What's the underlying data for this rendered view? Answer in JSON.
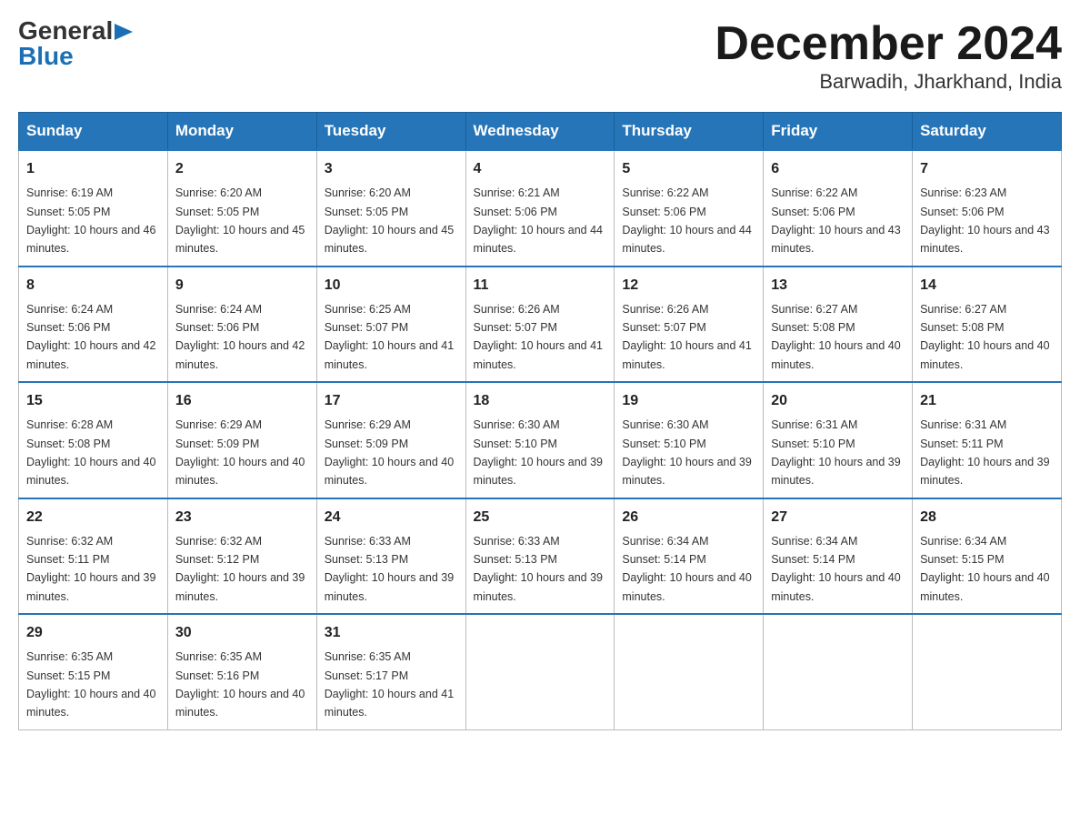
{
  "logo": {
    "general": "General",
    "blue": "Blue",
    "arrow": "▶"
  },
  "title": "December 2024",
  "subtitle": "Barwadih, Jharkhand, India",
  "weekdays": [
    "Sunday",
    "Monday",
    "Tuesday",
    "Wednesday",
    "Thursday",
    "Friday",
    "Saturday"
  ],
  "weeks": [
    [
      {
        "day": 1,
        "sunrise": "6:19 AM",
        "sunset": "5:05 PM",
        "daylight": "10 hours and 46 minutes."
      },
      {
        "day": 2,
        "sunrise": "6:20 AM",
        "sunset": "5:05 PM",
        "daylight": "10 hours and 45 minutes."
      },
      {
        "day": 3,
        "sunrise": "6:20 AM",
        "sunset": "5:05 PM",
        "daylight": "10 hours and 45 minutes."
      },
      {
        "day": 4,
        "sunrise": "6:21 AM",
        "sunset": "5:06 PM",
        "daylight": "10 hours and 44 minutes."
      },
      {
        "day": 5,
        "sunrise": "6:22 AM",
        "sunset": "5:06 PM",
        "daylight": "10 hours and 44 minutes."
      },
      {
        "day": 6,
        "sunrise": "6:22 AM",
        "sunset": "5:06 PM",
        "daylight": "10 hours and 43 minutes."
      },
      {
        "day": 7,
        "sunrise": "6:23 AM",
        "sunset": "5:06 PM",
        "daylight": "10 hours and 43 minutes."
      }
    ],
    [
      {
        "day": 8,
        "sunrise": "6:24 AM",
        "sunset": "5:06 PM",
        "daylight": "10 hours and 42 minutes."
      },
      {
        "day": 9,
        "sunrise": "6:24 AM",
        "sunset": "5:06 PM",
        "daylight": "10 hours and 42 minutes."
      },
      {
        "day": 10,
        "sunrise": "6:25 AM",
        "sunset": "5:07 PM",
        "daylight": "10 hours and 41 minutes."
      },
      {
        "day": 11,
        "sunrise": "6:26 AM",
        "sunset": "5:07 PM",
        "daylight": "10 hours and 41 minutes."
      },
      {
        "day": 12,
        "sunrise": "6:26 AM",
        "sunset": "5:07 PM",
        "daylight": "10 hours and 41 minutes."
      },
      {
        "day": 13,
        "sunrise": "6:27 AM",
        "sunset": "5:08 PM",
        "daylight": "10 hours and 40 minutes."
      },
      {
        "day": 14,
        "sunrise": "6:27 AM",
        "sunset": "5:08 PM",
        "daylight": "10 hours and 40 minutes."
      }
    ],
    [
      {
        "day": 15,
        "sunrise": "6:28 AM",
        "sunset": "5:08 PM",
        "daylight": "10 hours and 40 minutes."
      },
      {
        "day": 16,
        "sunrise": "6:29 AM",
        "sunset": "5:09 PM",
        "daylight": "10 hours and 40 minutes."
      },
      {
        "day": 17,
        "sunrise": "6:29 AM",
        "sunset": "5:09 PM",
        "daylight": "10 hours and 40 minutes."
      },
      {
        "day": 18,
        "sunrise": "6:30 AM",
        "sunset": "5:10 PM",
        "daylight": "10 hours and 39 minutes."
      },
      {
        "day": 19,
        "sunrise": "6:30 AM",
        "sunset": "5:10 PM",
        "daylight": "10 hours and 39 minutes."
      },
      {
        "day": 20,
        "sunrise": "6:31 AM",
        "sunset": "5:10 PM",
        "daylight": "10 hours and 39 minutes."
      },
      {
        "day": 21,
        "sunrise": "6:31 AM",
        "sunset": "5:11 PM",
        "daylight": "10 hours and 39 minutes."
      }
    ],
    [
      {
        "day": 22,
        "sunrise": "6:32 AM",
        "sunset": "5:11 PM",
        "daylight": "10 hours and 39 minutes."
      },
      {
        "day": 23,
        "sunrise": "6:32 AM",
        "sunset": "5:12 PM",
        "daylight": "10 hours and 39 minutes."
      },
      {
        "day": 24,
        "sunrise": "6:33 AM",
        "sunset": "5:13 PM",
        "daylight": "10 hours and 39 minutes."
      },
      {
        "day": 25,
        "sunrise": "6:33 AM",
        "sunset": "5:13 PM",
        "daylight": "10 hours and 39 minutes."
      },
      {
        "day": 26,
        "sunrise": "6:34 AM",
        "sunset": "5:14 PM",
        "daylight": "10 hours and 40 minutes."
      },
      {
        "day": 27,
        "sunrise": "6:34 AM",
        "sunset": "5:14 PM",
        "daylight": "10 hours and 40 minutes."
      },
      {
        "day": 28,
        "sunrise": "6:34 AM",
        "sunset": "5:15 PM",
        "daylight": "10 hours and 40 minutes."
      }
    ],
    [
      {
        "day": 29,
        "sunrise": "6:35 AM",
        "sunset": "5:15 PM",
        "daylight": "10 hours and 40 minutes."
      },
      {
        "day": 30,
        "sunrise": "6:35 AM",
        "sunset": "5:16 PM",
        "daylight": "10 hours and 40 minutes."
      },
      {
        "day": 31,
        "sunrise": "6:35 AM",
        "sunset": "5:17 PM",
        "daylight": "10 hours and 41 minutes."
      },
      null,
      null,
      null,
      null
    ]
  ]
}
